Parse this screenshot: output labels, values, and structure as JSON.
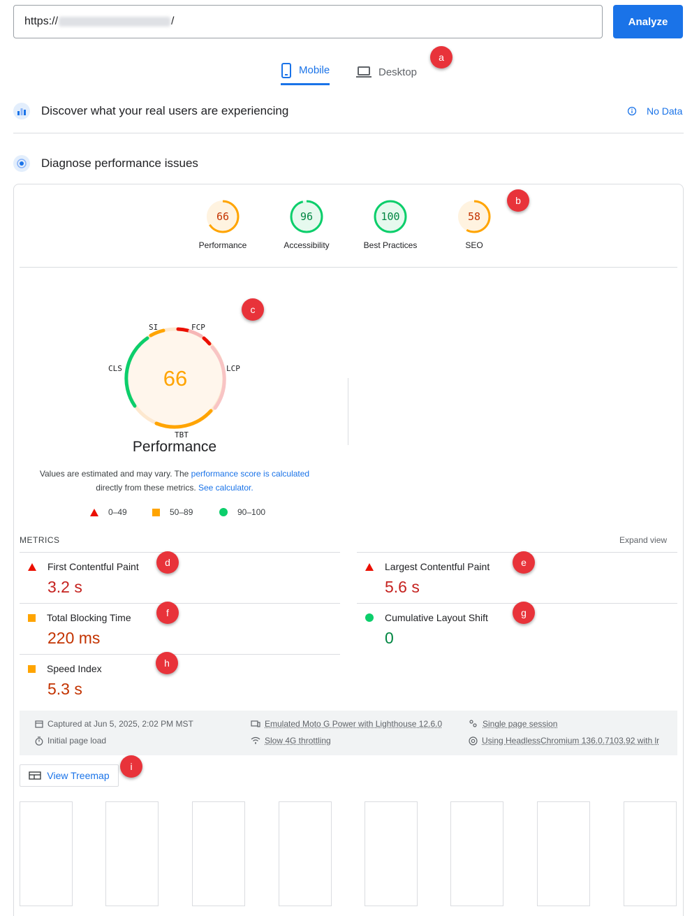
{
  "url_bar": {
    "prefix": "https://",
    "suffix": "/",
    "analyze_label": "Analyze"
  },
  "tabs": [
    {
      "label": "Mobile",
      "icon": "phone-icon",
      "active": true
    },
    {
      "label": "Desktop",
      "icon": "laptop-icon",
      "active": false
    }
  ],
  "markers": [
    "a",
    "b",
    "c",
    "d",
    "e",
    "f",
    "g",
    "h",
    "i"
  ],
  "field_data": {
    "title": "Discover what your real users are experiencing",
    "no_data_label": "No Data"
  },
  "diagnose": {
    "title": "Diagnose performance issues"
  },
  "categories": [
    {
      "label": "Performance",
      "score": "66",
      "score_value": 66,
      "status": "average"
    },
    {
      "label": "Accessibility",
      "score": "96",
      "score_value": 96,
      "status": "pass"
    },
    {
      "label": "Best Practices",
      "score": "100",
      "score_value": 100,
      "status": "pass"
    },
    {
      "label": "SEO",
      "score": "58",
      "score_value": 58,
      "status": "average"
    }
  ],
  "perf_gauge": {
    "score": "66",
    "title": "Performance",
    "segment_labels": {
      "si": "SI",
      "fcp": "FCP",
      "lcp": "LCP",
      "tbt": "TBT",
      "cls": "CLS"
    }
  },
  "description": {
    "text1": "Values are estimated and may vary. The ",
    "link1": "performance score is calculated",
    "text2": "directly from these metrics. ",
    "link2": "See calculator."
  },
  "legend": [
    {
      "range": "0–49",
      "shape": "triangle"
    },
    {
      "range": "50–89",
      "shape": "square"
    },
    {
      "range": "90–100",
      "shape": "circle"
    }
  ],
  "metrics": {
    "title": "METRICS",
    "expand_label": "Expand view",
    "items": [
      {
        "name": "First Contentful Paint",
        "value": "3.2 s",
        "status": "fail"
      },
      {
        "name": "Largest Contentful Paint",
        "value": "5.6 s",
        "status": "fail"
      },
      {
        "name": "Total Blocking Time",
        "value": "220 ms",
        "status": "average"
      },
      {
        "name": "Cumulative Layout Shift",
        "value": "0",
        "status": "pass"
      },
      {
        "name": "Speed Index",
        "value": "5.3 s",
        "status": "average"
      }
    ]
  },
  "run_info": {
    "captured": "Captured at Jun 5, 2025, 2:02 PM MST",
    "page_load": "Initial page load",
    "device": "Emulated Moto G Power with Lighthouse 12.6.0",
    "throttling": "Slow 4G throttling",
    "session": "Single page session",
    "browser": "Using HeadlessChromium 136.0.7103.92 with lr"
  },
  "treemap_label": "View Treemap",
  "colors": {
    "accent": "#1a73e8",
    "fail": "#eb0f00",
    "average": "#ffa400",
    "pass": "#0cce6b"
  }
}
